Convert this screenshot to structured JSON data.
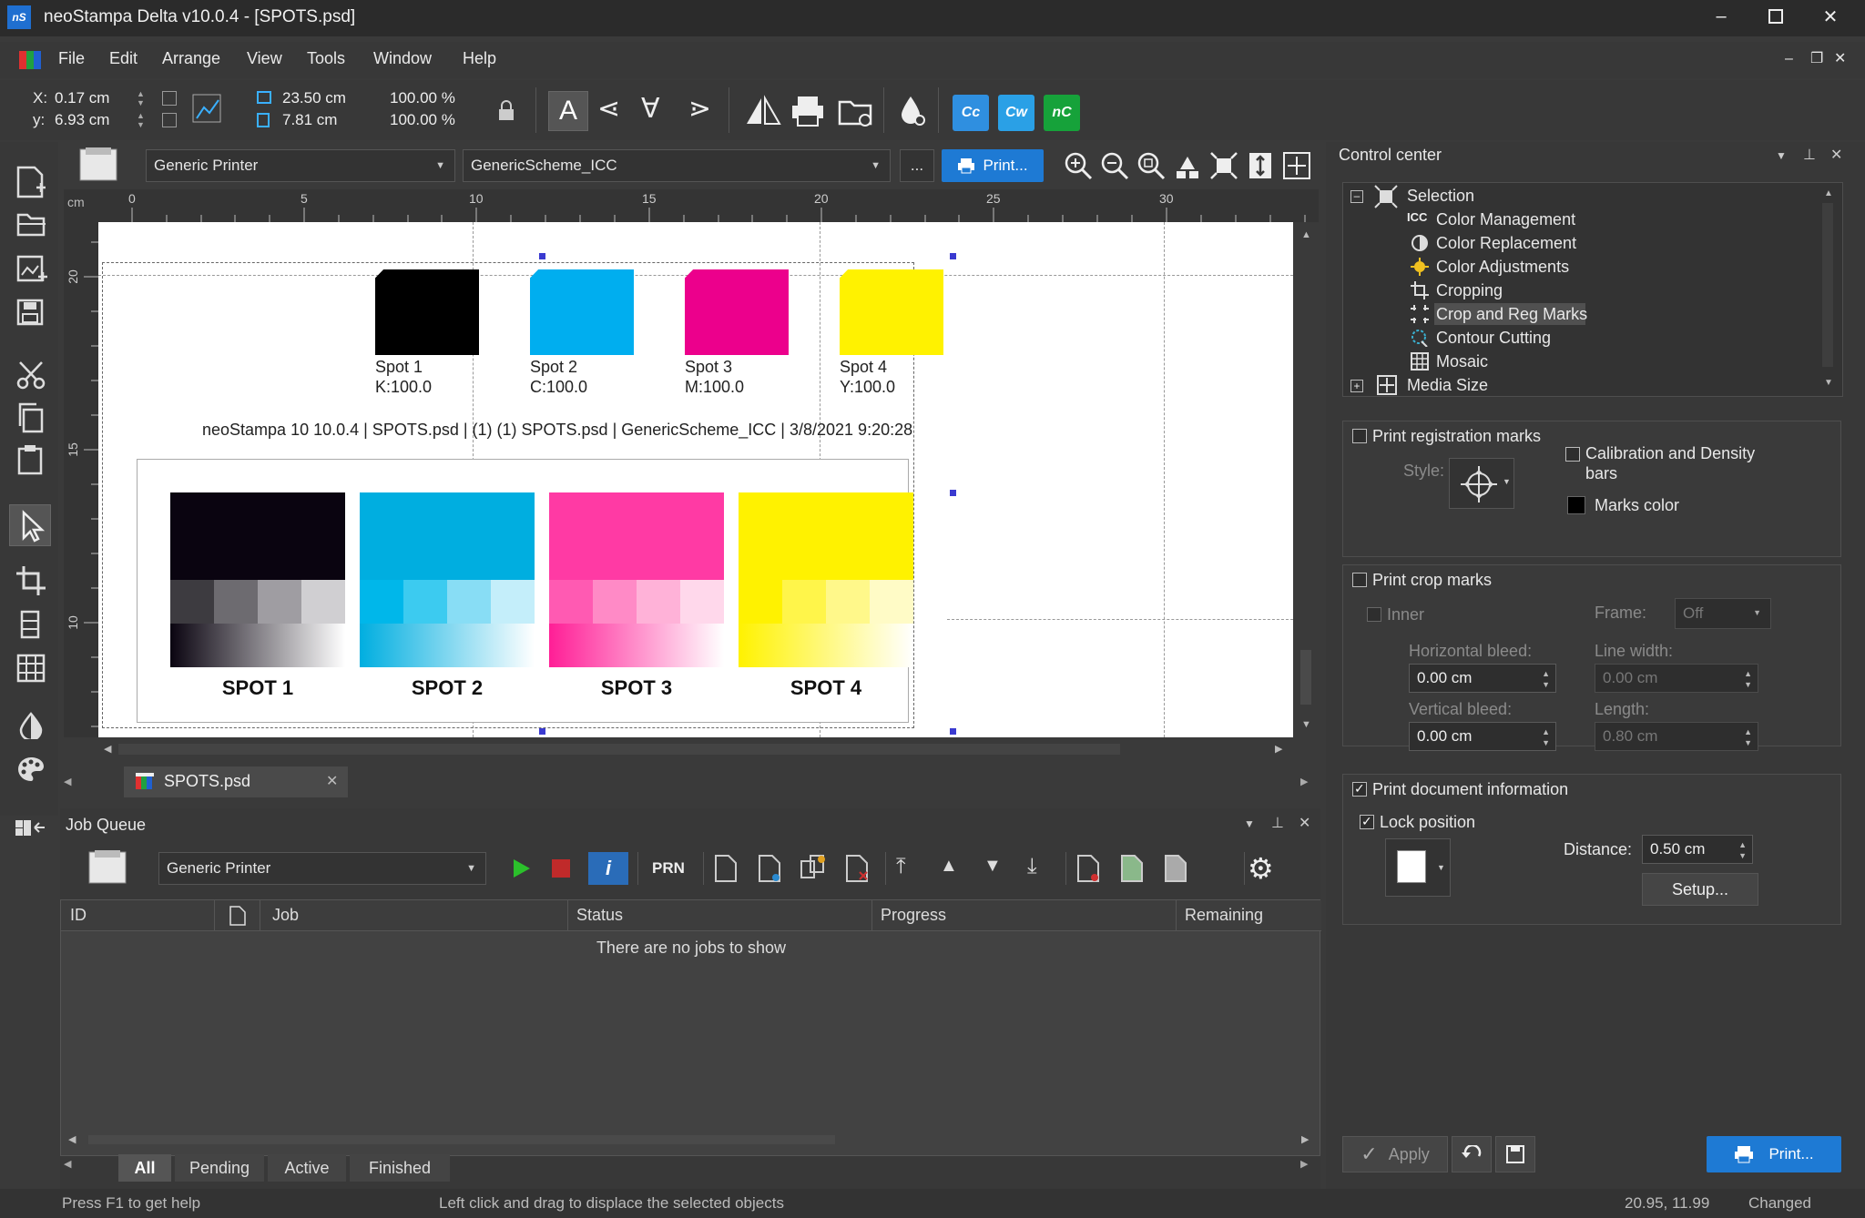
{
  "app": {
    "logo": "nS",
    "title": "neoStampa Delta  v10.0.4 - [SPOTS.psd]"
  },
  "menu": [
    "File",
    "Edit",
    "Arrange",
    "View",
    "Tools",
    "Window",
    "Help"
  ],
  "toolbar": {
    "x_label": "X:",
    "x_value": "0.17 cm",
    "y_label": "y:",
    "y_value": "6.93 cm",
    "w_value": "23.50 cm",
    "h_value": "7.81 cm",
    "sx_value": "100.00 %",
    "sy_value": "100.00 %",
    "cc_label": "Cc",
    "cw_label": "Cw",
    "nc_label": "nC"
  },
  "printer_bar": {
    "printer": "Generic Printer",
    "scheme": "GenericScheme_ICC",
    "more": "...",
    "print": "Print..."
  },
  "ruler": {
    "unit": "cm",
    "h_ticks": [
      "0",
      "5",
      "10",
      "15",
      "20",
      "25",
      "30"
    ],
    "v_ticks": [
      "20",
      "15",
      "10"
    ]
  },
  "canvas": {
    "spots": [
      {
        "name": "Spot 1",
        "value": "K:100.0",
        "color": "#000000"
      },
      {
        "name": "Spot 2",
        "value": "C:100.0",
        "color": "#00aeef"
      },
      {
        "name": "Spot 3",
        "value": "M:100.0",
        "color": "#ec008c"
      },
      {
        "name": "Spot 4",
        "value": "Y:100.0",
        "color": "#fff200"
      }
    ],
    "doc_info": "neoStampa 10 10.0.4 | SPOTS.psd | (1) (1) SPOTS.psd | GenericScheme_ICC | 3/8/2021 9:20:28",
    "swatches": [
      "SPOT 1",
      "SPOT 2",
      "SPOT 3",
      "SPOT 4"
    ]
  },
  "doc_tab": {
    "label": "SPOTS.psd"
  },
  "job_queue": {
    "title": "Job Queue",
    "printer": "Generic Printer",
    "prn": "PRN",
    "columns": [
      "ID",
      "Job",
      "Status",
      "Progress",
      "Remaining"
    ],
    "empty": "There are no jobs to show",
    "tabs": [
      "All",
      "Pending",
      "Active",
      "Finished"
    ]
  },
  "control_center": {
    "title": "Control center",
    "tree": [
      {
        "label": "Selection",
        "icon": "selection-icon",
        "level": 0
      },
      {
        "label": "Color Management",
        "icon": "icc-icon",
        "level": 1,
        "prefix": "ICC"
      },
      {
        "label": "Color Replacement",
        "icon": "color-replacement-icon",
        "level": 1
      },
      {
        "label": "Color Adjustments",
        "icon": "color-adjustments-icon",
        "level": 1
      },
      {
        "label": "Cropping",
        "icon": "crop-icon",
        "level": 1
      },
      {
        "label": "Crop and Reg Marks",
        "icon": "crop-reg-marks-icon",
        "level": 1,
        "selected": true
      },
      {
        "label": "Contour Cutting",
        "icon": "contour-cutting-icon",
        "level": 1
      },
      {
        "label": "Mosaic",
        "icon": "mosaic-icon",
        "level": 1
      },
      {
        "label": "Media Size",
        "icon": "media-size-icon",
        "level": 0
      }
    ],
    "reg": {
      "print_reg": "Print registration marks",
      "style": "Style:",
      "calibration": "Calibration and Density bars",
      "marks_color": "Marks color"
    },
    "crop": {
      "print_crop": "Print crop marks",
      "inner": "Inner",
      "frame": "Frame:",
      "frame_value": "Off",
      "hbleed": "Horizontal bleed:",
      "hbleed_value": "0.00 cm",
      "linewidth": "Line width:",
      "linewidth_value": "0.00 cm",
      "vbleed": "Vertical bleed:",
      "vbleed_value": "0.00 cm",
      "length": "Length:",
      "length_value": "0.80 cm"
    },
    "docinfo": {
      "print_doc": "Print document information",
      "lock": "Lock position",
      "distance": "Distance:",
      "distance_value": "0.50 cm",
      "setup": "Setup..."
    },
    "apply": "Apply",
    "print": "Print..."
  },
  "status": {
    "help": "Press F1 to get help",
    "hint": "Left click and drag to displace the selected objects",
    "coords": "20.95, 11.99",
    "state": "Changed"
  }
}
